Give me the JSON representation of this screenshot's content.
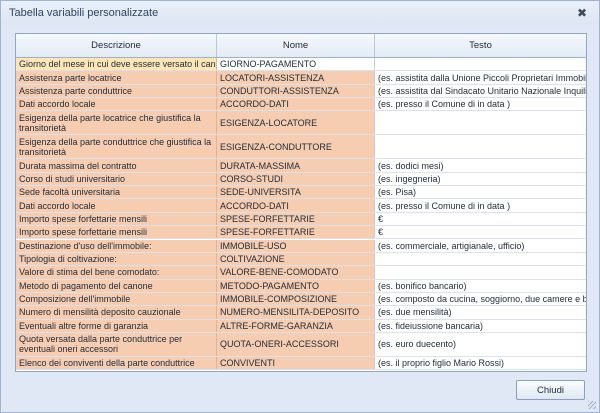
{
  "window": {
    "title": "Tabella variabili personalizzate",
    "close_glyph": "✖"
  },
  "table": {
    "headers": [
      "Descrizione",
      "Nome",
      "Testo"
    ],
    "rows": [
      {
        "descrizione": "Giorno del mese in cui deve essere versato il canone",
        "nome": "GIORNO-PAGAMENTO",
        "testo": ""
      },
      {
        "descrizione": "Assistenza parte locatrice",
        "nome": "LOCATORI-ASSISTENZA",
        "testo": "(es. assistita dalla Unione Piccoli Proprietari Immobiliari)"
      },
      {
        "descrizione": "Assistenza parte conduttrice",
        "nome": "CONDUTTORI-ASSISTENZA",
        "testo": "(es. assistita dal Sindacato Unitario Nazionale Inquilini ..."
      },
      {
        "descrizione": "Dati accordo locale",
        "nome": "ACCORDO-DATI",
        "testo": "(es. presso il Comune di    in data    )"
      },
      {
        "descrizione": "Esigenza della parte locatrice che giustifica la transitorietà",
        "nome": "ESIGENZA-LOCATORE",
        "testo": ""
      },
      {
        "descrizione": "Esigenza della parte conduttrice che giustifica la transitorietà",
        "nome": "ESIGENZA-CONDUTTORE",
        "testo": ""
      },
      {
        "descrizione": "Durata massima del contratto",
        "nome": "DURATA-MASSIMA",
        "testo": "(es. dodici mesi)"
      },
      {
        "descrizione": "Corso di studi universitario",
        "nome": "CORSO-STUDI",
        "testo": "(es. ingegneria)"
      },
      {
        "descrizione": "Sede facoltà universitaria",
        "nome": "SEDE-UNIVERSITA",
        "testo": "(es. Pisa)"
      },
      {
        "descrizione": "Dati accordo locale",
        "nome": "ACCORDO-DATI",
        "testo": "(es. presso il Comune di    in data    )"
      },
      {
        "descrizione": "Importo spese forfettarie mensili",
        "nome": "SPESE-FORFETTARIE",
        "testo": "€"
      },
      {
        "descrizione": "Importo spese forfettarie mensili",
        "nome": "SPESE-FORFETTARIE",
        "testo": "€"
      },
      {
        "descrizione": "Destinazione d'uso dell'immobile:",
        "nome": "IMMOBILE-USO",
        "testo": "(es. commerciale, artigianale, ufficio)"
      },
      {
        "descrizione": "Tipologia di coltivazione:",
        "nome": "COLTIVAZIONE",
        "testo": ""
      },
      {
        "descrizione": "Valore di stima del bene comodato:",
        "nome": "VALORE-BENE-COMODATO",
        "testo": ""
      },
      {
        "descrizione": "Metodo di pagamento del canone",
        "nome": "METODO-PAGAMENTO",
        "testo": "(es. bonifico bancario)"
      },
      {
        "descrizione": "Composizione dell'immobile",
        "nome": "IMMOBILE-COMPOSIZIONE",
        "testo": "(es. composto da cucina, soggiorno, due camere e bag..."
      },
      {
        "descrizione": "Numero di mensilità deposito cauzionale",
        "nome": "NUMERO-MENSILITA-DEPOSITO",
        "testo": "(es. due mensilità)"
      },
      {
        "descrizione": "Eventuali altre forme di garanzia",
        "nome": "ALTRE-FORME-GARANZIA",
        "testo": "(es. fideiussione bancaria)"
      },
      {
        "descrizione": "Quota versata dalla parte conduttrice per eventuali oneri accessori",
        "nome": "QUOTA-ONERI-ACCESSORI",
        "testo": "(es. euro duecento)"
      },
      {
        "descrizione": "Elenco dei conviventi della parte conduttrice",
        "nome": "CONVIVENTI",
        "testo": "(es. il proprio figlio Mario Rossi)"
      }
    ]
  },
  "footer": {
    "close_button": "Chiudi"
  }
}
